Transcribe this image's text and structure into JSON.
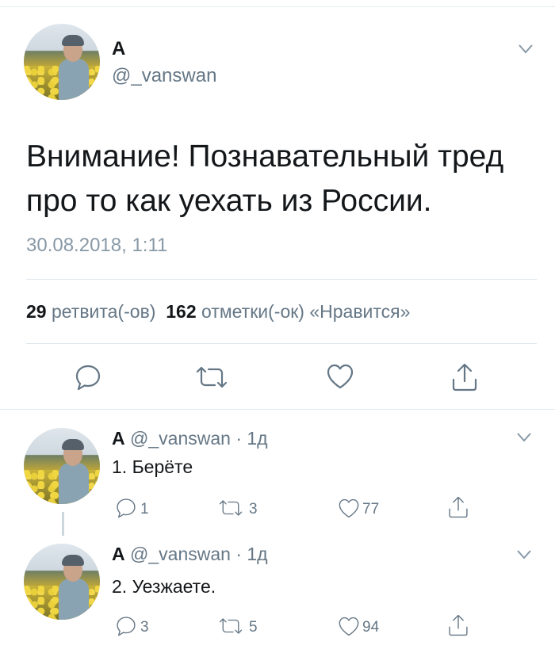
{
  "main_tweet": {
    "name": "А",
    "handle": "@_vanswan",
    "text_line1": "Внимание! Познавательный тред",
    "text_line2": "про то как уехать из России.",
    "timestamp": "30.08.2018, 1:11",
    "stats": {
      "retweets_count": "29",
      "retweets_label": "ретвита(-ов)",
      "likes_count": "162",
      "likes_label": "отметки(-ок) «Нравится»"
    }
  },
  "replies": [
    {
      "name": "А",
      "handle": "@_vanswan",
      "time": "· 1д",
      "text": "1. Берёте",
      "reply_count": "1",
      "retweet_count": "3",
      "like_count": "77"
    },
    {
      "name": "А",
      "handle": "@_vanswan",
      "time": "· 1д",
      "text": "2. Уезжаете.",
      "reply_count": "3",
      "retweet_count": "5",
      "like_count": "94"
    }
  ],
  "icons": [
    "chevron-down-icon",
    "reply-icon",
    "retweet-icon",
    "like-icon",
    "share-icon"
  ],
  "colors": {
    "text": "#14171a",
    "secondary": "#657786",
    "divider": "#e1e8ed"
  }
}
